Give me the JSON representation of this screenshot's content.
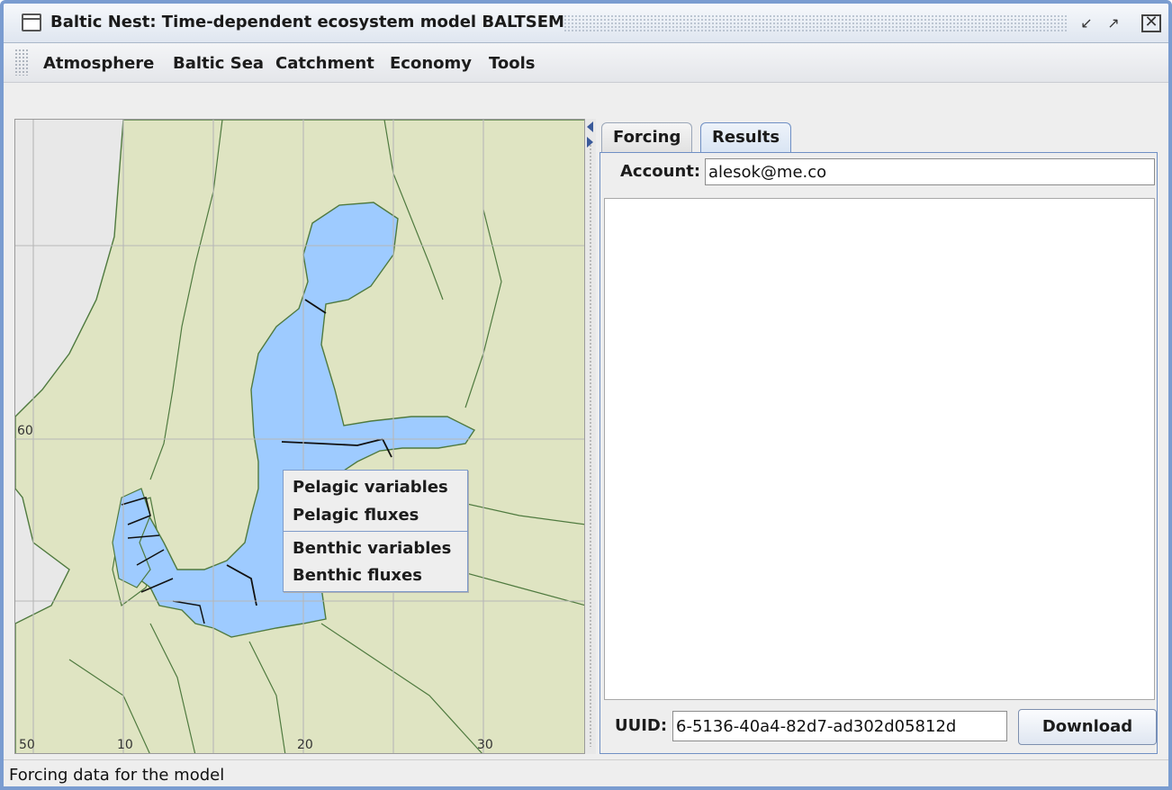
{
  "window": {
    "title": "Baltic Nest: Time-dependent ecosystem model BALTSEM",
    "controls": [
      "minimize-icon",
      "maximize-icon",
      "close-icon"
    ]
  },
  "menubar": {
    "items": [
      "Atmosphere",
      "Baltic Sea",
      "Catchment",
      "Economy",
      "Tools"
    ]
  },
  "map": {
    "lat_labels": [
      "60"
    ],
    "lon_labels": [
      "50",
      "10",
      "20",
      "30"
    ],
    "colors": {
      "land": "#dfe4c2",
      "sea": "#9ecbff",
      "coast": "#4f7a3f",
      "grid": "#b7b7b7",
      "outside": "#e8e8e8"
    }
  },
  "context_menu": {
    "items": [
      "Pelagic variables",
      "Pelagic fluxes",
      "Benthic variables",
      "Benthic fluxes"
    ]
  },
  "tabs": [
    {
      "label": "Forcing",
      "active": false
    },
    {
      "label": "Results",
      "active": true
    }
  ],
  "results": {
    "account_label": "Account:",
    "account_value": "alesok@me.co",
    "uuid_label": "UUID:",
    "uuid_value": "6-5136-40a4-82d7-ad302d05812d",
    "download_label": "Download"
  },
  "status": {
    "text": "Forcing data for the model"
  }
}
